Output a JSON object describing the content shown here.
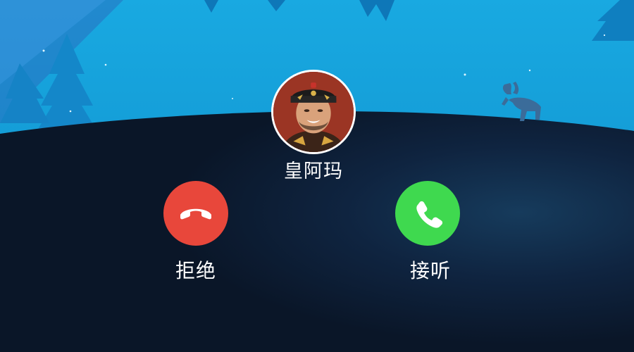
{
  "call": {
    "caller_name": "皇阿玛",
    "decline_label": "拒绝",
    "accept_label": "接听"
  },
  "icons": {
    "decline": "phone-hangup-icon",
    "accept": "phone-icon",
    "avatar": "caller-avatar-photo",
    "background": "night-forest-moose-scene"
  },
  "colors": {
    "sky": "#12a7dc",
    "ground": "#0b1628",
    "decline": "#e8473b",
    "accept": "#3fd94f",
    "text": "#ffffff"
  }
}
